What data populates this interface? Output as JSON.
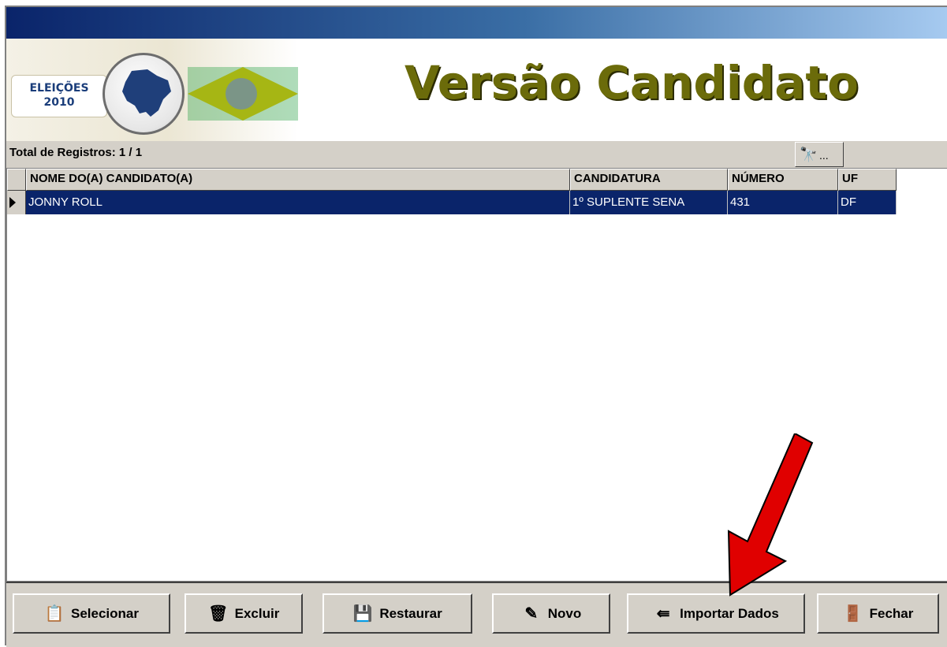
{
  "header": {
    "logo_line1": "ELEIÇÕES",
    "logo_line2": "2010",
    "title": "Versão Candidato"
  },
  "toolbar": {
    "total_label": "Total de Registros: 1 / 1",
    "search_icon": "binoculars-icon",
    "search_ellipsis": "..."
  },
  "grid": {
    "columns": [
      "NOME DO(A) CANDIDATO(A)",
      "CANDIDATURA",
      "NÚMERO",
      "UF"
    ],
    "rows": [
      {
        "nome": "JONNY ROLL",
        "candidatura": "1º SUPLENTE SENA",
        "numero": "431",
        "uf": "DF"
      }
    ]
  },
  "buttons": {
    "selecionar": "Selecionar",
    "excluir": "Excluir",
    "restaurar": "Restaurar",
    "novo": "Novo",
    "importar": "Importar Dados",
    "fechar": "Fechar"
  },
  "colors": {
    "selection": "#0a246a",
    "title": "#6b6b0a",
    "annotation_arrow": "#e00000"
  },
  "icons": [
    "binoculars-icon",
    "checklist-icon",
    "trash-icon",
    "save-icon",
    "new-document-icon",
    "import-icon",
    "exit-door-icon",
    "red-arrow"
  ]
}
